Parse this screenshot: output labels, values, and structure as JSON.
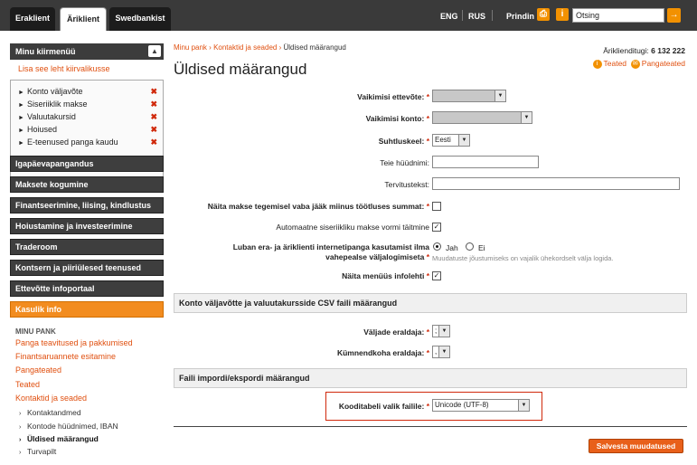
{
  "topbar": {
    "tabs": [
      "Eraklient",
      "Äriklient",
      "Swedbankist"
    ],
    "lang_eng": "ENG",
    "lang_rus": "RUS",
    "print": "Prindin",
    "search_value": "Otsing"
  },
  "sidebar": {
    "quick_menu_title": "Minu kiirmenüü",
    "add_page": "Lisa see leht kiirvalikusse",
    "quick_items": [
      "Konto väljavõte",
      "Siseriiklik makse",
      "Valuutakursid",
      "Hoiused",
      "E-teenused panga kaudu"
    ],
    "nav": [
      "Igapäevapangandus",
      "Maksete kogumine",
      "Finantseerimine, liising, kindlustus",
      "Hoiustamine ja investeerimine",
      "Traderoom",
      "Kontsern ja piiriülesed teenused",
      "Ettevõtte infoportaal",
      "Kasulik info"
    ],
    "my_bank_label": "MINU PANK",
    "my_bank_links": [
      "Panga teavitused ja pakkumised",
      "Finantsaruannete esitamine",
      "Pangateated",
      "Teated",
      "Kontaktid ja seaded"
    ],
    "my_bank_sub": [
      "Kontaktandmed",
      "Kontode hüüdnimed, IBAN",
      "Üldised määrangud",
      "Turvapilt"
    ]
  },
  "main": {
    "crumb_1": "Minu pank",
    "crumb_sep": "›",
    "crumb_2": "Kontaktid ja seaded",
    "crumb_3": "Üldised määrangud",
    "client_id_label": "Äriklienditugi:",
    "client_id_value": "6 132 222",
    "title": "Üldised määrangud",
    "link_teated": "Teated",
    "link_pangateated": "Pangateated",
    "fields": {
      "default_company": "Vaikimisi ettevõte:",
      "default_account": "Vaikimisi konto:",
      "language": "Suhtluskeel:",
      "language_value": "Eesti",
      "nickname": "Teie hüüdnimi:",
      "greeting": "Tervitustekst:",
      "show_balance": "Näita makse tegemisel vaba jääk miinus töötluses summat:",
      "auto_fill": "Automaatne siseriikliku makse vormi täitmine",
      "allow_line1": "Luban era- ja äriklienti internetipanga kasutamist ilma",
      "allow_line2": "vahepealse väljalogimiseta",
      "allow_yes": "Jah",
      "allow_no": "Ei",
      "allow_hint": "Muudatuste jõustumiseks on vajalik ühekordselt välja logida.",
      "show_info": "Näita menüüs infolehti"
    },
    "section_csv": "Konto väljavõtte ja valuutakursside CSV faili määrangud",
    "field_separator": "Väljade eraldaja:",
    "field_separator_value": ";",
    "decimal_separator": "Kümnendkoha eraldaja:",
    "decimal_separator_value": ",",
    "section_import": "Faili impordi/ekspordi määrangud",
    "encoding_label": "Kooditabeli valik failile:",
    "encoding_value": "Unicode (UTF-8)",
    "required_mark": "*",
    "save_button": "Salvesta muudatused"
  }
}
